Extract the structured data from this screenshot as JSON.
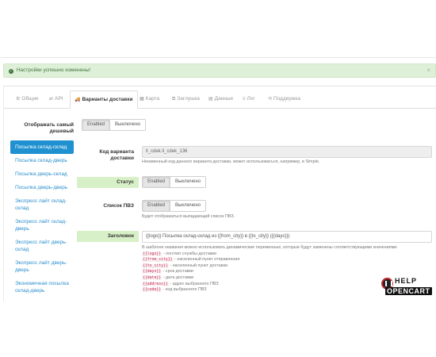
{
  "alert": {
    "text": "Настройки успешно изменены!",
    "close": "×"
  },
  "tabs": [
    {
      "icon": "⚙",
      "label": "Общие"
    },
    {
      "icon": "⇄",
      "label": "API"
    },
    {
      "icon": "🚚",
      "label": "Варианты доставки"
    },
    {
      "icon": "▦",
      "label": "Карта"
    },
    {
      "icon": "⧉",
      "label": "Заглушка"
    },
    {
      "icon": "▤",
      "label": "Данные"
    },
    {
      "icon": "≡",
      "label": "Лог"
    },
    {
      "icon": "⟲",
      "label": "Поддержка"
    }
  ],
  "show_cheapest": {
    "label": "Отображать самый дешевый",
    "on": "Enabled",
    "off": "Выключено"
  },
  "sidebar": [
    "Посылка склад-склад",
    "Посылка склад-дверь",
    "Посылка дверь-склад",
    "Посылка дверь-дверь",
    "Экспресс лайт склад-склад",
    "Экспресс лайт склад-дверь",
    "Экспресс лайт дверь-склад",
    "Экспресс лайт дверь-дверь",
    "Экономичная посылка склад-дверь"
  ],
  "delivery_code": {
    "label": "Код варианта доставки",
    "value": "ll_cdek.ll_cdek_136",
    "help": "Неизменный код данного варианта доставки, может использоваться, например, в Simple."
  },
  "status": {
    "label": "Статус",
    "on": "Enabled",
    "off": "Выключено"
  },
  "pvz_list": {
    "label": "Список ПВЗ",
    "on": "Enabled",
    "off": "Выключено",
    "help": "Будет отображаться выпадающий список ПВЗ."
  },
  "heading": {
    "label": "Заголовок",
    "value": "{{logo}} Посылка склад-склад из {{from_city}} в {{to_city}} ({{days}})",
    "help_intro": "В шаблоне названия можно использовать динамические переменные, которые будут заменены соответствующими значениями:",
    "vars": [
      {
        "code": "{{logo}}",
        "desc": " - логотип службы доставки"
      },
      {
        "code": "{{from_city}}",
        "desc": " - населенный пункт отправления"
      },
      {
        "code": "{{to_city}}",
        "desc": " - населенный пункт доставки"
      },
      {
        "code": "{{days}}",
        "desc": " - срок доставки"
      },
      {
        "code": "{{date}}",
        "desc": " - дата доставки"
      },
      {
        "code": "{{address}}",
        "desc": " - адрес выбранного ПВЗ"
      },
      {
        "code": "{{code}}",
        "desc": " - код выбранного ПВЗ"
      }
    ]
  },
  "logo": {
    "line1": "HELP",
    "line2": "OPENCART"
  }
}
